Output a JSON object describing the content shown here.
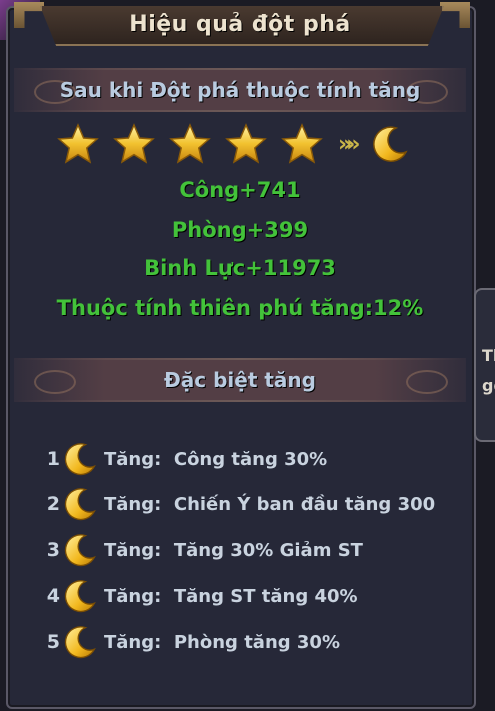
{
  "title": "Hiệu quả đột phá",
  "breakthrough": {
    "heading": "Sau khi Đột phá thuộc tính tăng",
    "stars_icon": "star-icon",
    "arrow_text": "»»",
    "moon_icon": "crescent-moon-icon"
  },
  "stats": [
    "Công+741",
    "Phòng+399",
    "Binh Lực+11973",
    "Thuộc tính thiên phú tăng:12%"
  ],
  "special": {
    "heading": "Đặc biệt tăng",
    "items": [
      {
        "num": "1",
        "label": "Tăng:  Công tăng 30%"
      },
      {
        "num": "2",
        "label": "Tăng:  Chiến Ý ban đầu tăng 300"
      },
      {
        "num": "3",
        "label": "Tăng:  Tăng 30% Giảm ST"
      },
      {
        "num": "4",
        "label": "Tăng:  Tăng ST tăng 40%"
      },
      {
        "num": "5",
        "label": "Tăng:  Phòng tăng 30%"
      }
    ]
  },
  "side_tab": {
    "line1": "Th",
    "line2": "gg"
  },
  "colors": {
    "stat_green": "#43c23a",
    "heading_blue": "#b9cbe0",
    "gold": "#f2c230"
  }
}
